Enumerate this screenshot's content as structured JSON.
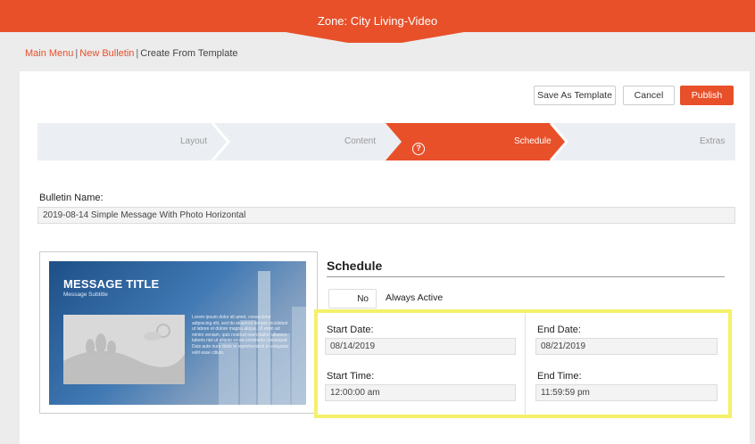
{
  "header": {
    "zone_title": "Zone: City Living-Video",
    "accent_color": "#e8502a"
  },
  "breadcrumb": {
    "main_menu": "Main Menu",
    "separator": "|",
    "new_bulletin": "New Bulletin",
    "current": "Create From Template"
  },
  "toolbar": {
    "save_template": "Save As Template",
    "cancel": "Cancel",
    "publish": "Publish"
  },
  "steps": [
    {
      "label": "Layout",
      "active": false
    },
    {
      "label": "Content",
      "active": false,
      "icon": "help-circle-icon"
    },
    {
      "label": "Schedule",
      "active": true
    },
    {
      "label": "Extras",
      "active": false
    }
  ],
  "bulletin": {
    "name_label": "Bulletin Name:",
    "name_value": "2019-08-14 Simple Message With Photo Horizontal"
  },
  "preview": {
    "title": "MESSAGE TITLE",
    "subtitle": "Message Subtitle",
    "body": "Lorem ipsum dolor sit amet, consectetur adipiscing elit, sed do eiusmod tempor incididunt ut labore et dolore magna aliqua. Ut enim ad minim veniam, quis nostrud exercitation ullamco laboris nisi ut aliquip ex ea commodo consequat. Duis aute irure dolor in reprehenderit in voluptate velit esse cillum."
  },
  "schedule": {
    "title": "Schedule",
    "toggle_value": "No",
    "always_active_label": "Always Active",
    "start_date_label": "Start Date:",
    "start_date": "08/14/2019",
    "end_date_label": "End Date:",
    "end_date": "08/21/2019",
    "start_time_label": "Start Time:",
    "start_time": "12:00:00 am",
    "end_time_label": "End Time:",
    "end_time": "11:59:59 pm",
    "highlight_color": "#f4f06a"
  }
}
